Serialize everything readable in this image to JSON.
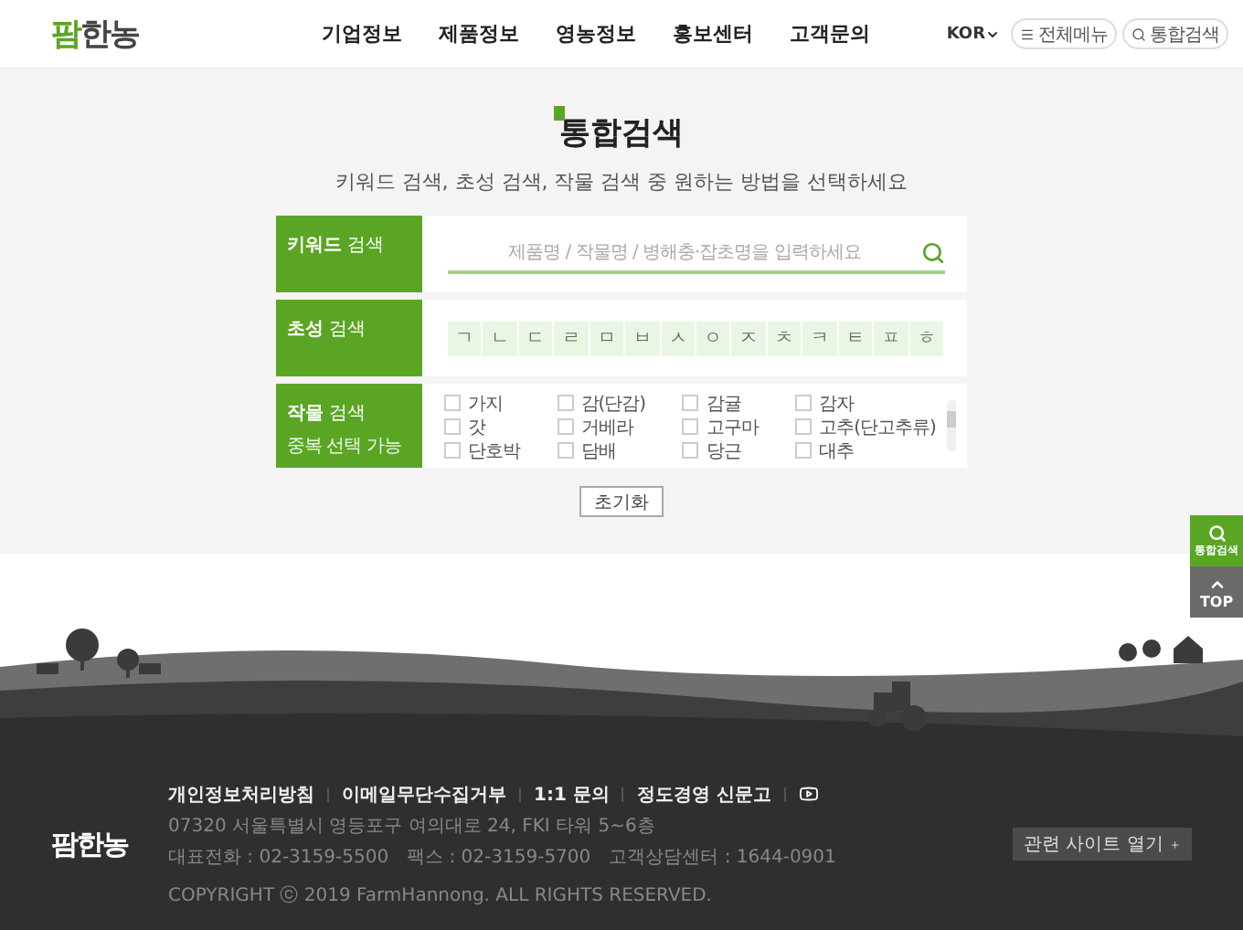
{
  "header": {
    "logo": {
      "accent": "팜",
      "rest": "한농"
    },
    "nav": [
      "기업정보",
      "제품정보",
      "영농정보",
      "홍보센터",
      "고객문의"
    ],
    "language": "KOR",
    "menu_button": "전체메뉴",
    "search_button": "통합검색"
  },
  "title": "통합검색",
  "subtitle": "키워드 검색, 초성 검색, 작물 검색 중 원하는 방법을 선택하세요",
  "keyword_panel": {
    "label": "**키워드** 검색",
    "placeholder": "제품명 / 작물명 / 병해충·잡초명을 입력하세요"
  },
  "initial_panel": {
    "label": "**초성** 검색",
    "consonants": [
      {
        "text": "ㄱ",
        "selected": false
      },
      {
        "text": "ㄴ",
        "selected": false
      },
      {
        "text": "ㄷ",
        "selected": false
      },
      {
        "text": "ㄹ",
        "selected": false
      },
      {
        "text": "ㅁ",
        "selected": false
      },
      {
        "text": "ㅂ",
        "selected": false
      },
      {
        "text": "ㅅ",
        "selected": false
      },
      {
        "text": "ㅇ",
        "selected": false
      },
      {
        "text": "ㅈ",
        "selected": false
      },
      {
        "text": "ㅊ",
        "selected": false
      },
      {
        "text": "ㅋ",
        "selected": false
      },
      {
        "text": "ㅌ",
        "selected": false
      },
      {
        "text": "ㅍ",
        "selected": false
      },
      {
        "text": "ㅎ",
        "selected": false
      }
    ]
  },
  "crop_panel": {
    "label": "**작물** 검색",
    "note": "중복 선택 가능",
    "crops": [
      {
        "label": "가지",
        "checked": false
      },
      {
        "label": "감(단감)",
        "checked": false
      },
      {
        "label": "감귤",
        "checked": false
      },
      {
        "label": "감자",
        "checked": false
      },
      {
        "label": "갓",
        "checked": false
      },
      {
        "label": "거베라",
        "checked": false
      },
      {
        "label": "고구마",
        "checked": false
      },
      {
        "label": "고추(단고추류)",
        "checked": false
      },
      {
        "label": "단호박",
        "checked": false
      },
      {
        "label": "담배",
        "checked": false
      },
      {
        "label": "당근",
        "checked": false
      },
      {
        "label": "대추",
        "checked": false
      }
    ]
  },
  "reset_button": "초기화",
  "side_buttons": {
    "search": "통합검색",
    "top": "TOP"
  },
  "footer": {
    "logo": "팜한농",
    "links": [
      "개인정보처리방침",
      "이메일무단수집거부",
      "1:1 문의",
      "정도경영 신문고"
    ],
    "address": "07320 서울특별시 영등포구 여의대로 24, FKI 타워 5~6층",
    "contacts": [
      "대표전화 : 02-3159-5500",
      "팩스 : 02-3159-5700",
      "고객상담센터 : 1644-0901"
    ],
    "copyright": "COPYRIGHT ⓒ 2019 FarmHannong. ALL RIGHTS RESERVED.",
    "related_sites": "관련 사이트 열기"
  }
}
